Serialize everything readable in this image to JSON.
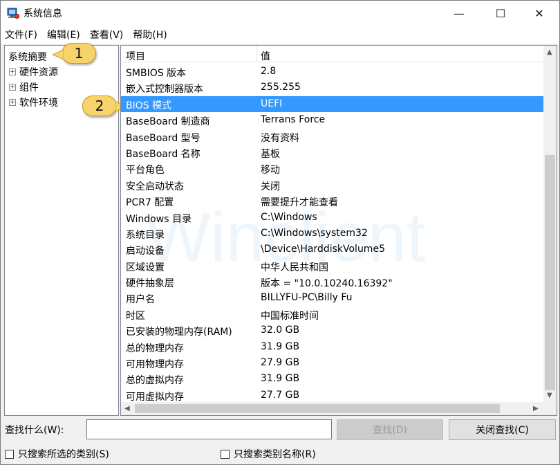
{
  "window": {
    "title": "系统信息",
    "minimize_glyph": "—",
    "maximize_glyph": "☐",
    "close_glyph": "✕"
  },
  "menu": [
    "文件(F)",
    "编辑(E)",
    "查看(V)",
    "帮助(H)"
  ],
  "tree": {
    "root": "系统摘要",
    "children": [
      "硬件资源",
      "组件",
      "软件环境"
    ],
    "expander": "+"
  },
  "callouts": [
    "1",
    "2"
  ],
  "list": {
    "headers": [
      "项目",
      "值"
    ],
    "rows": [
      [
        "SMBIOS 版本",
        "2.8"
      ],
      [
        "嵌入式控制器版本",
        "255.255"
      ],
      [
        "BIOS 模式",
        "UEFI"
      ],
      [
        "BaseBoard 制造商",
        "Terrans Force"
      ],
      [
        "BaseBoard 型号",
        "没有资料"
      ],
      [
        "BaseBoard 名称",
        "基板"
      ],
      [
        "平台角色",
        "移动"
      ],
      [
        "安全启动状态",
        "关闭"
      ],
      [
        "PCR7 配置",
        "需要提升才能查看"
      ],
      [
        "Windows 目录",
        "C:\\Windows"
      ],
      [
        "系统目录",
        "C:\\Windows\\system32"
      ],
      [
        "启动设备",
        "\\Device\\HarddiskVolume5"
      ],
      [
        "区域设置",
        "中华人民共和国"
      ],
      [
        "硬件抽象层",
        "版本 = \"10.0.10240.16392\""
      ],
      [
        "用户名",
        "BILLYFU-PC\\Billy Fu"
      ],
      [
        "时区",
        "中国标准时间"
      ],
      [
        "已安装的物理内存(RAM)",
        "32.0 GB"
      ],
      [
        "总的物理内存",
        "31.9 GB"
      ],
      [
        "可用物理内存",
        "27.9 GB"
      ],
      [
        "总的虚拟内存",
        "31.9 GB"
      ],
      [
        "可用虚拟内存",
        "27.7 GB"
      ]
    ],
    "selected_index": 2,
    "watermark": "Winclient"
  },
  "find": {
    "label": "查找什么(W):",
    "input_value": "",
    "find_button": "查找(D)",
    "close_button": "关闭查找(C)",
    "check1": "只搜索所选的类别(S)",
    "check2": "只搜索类别名称(R)"
  },
  "colors": {
    "selection": "#3399ff",
    "callout": "#f6d36b"
  },
  "icons": {
    "app": "system-info-icon",
    "scroll_up": "▲",
    "scroll_down": "▼",
    "scroll_left": "◀",
    "scroll_right": "▶"
  }
}
